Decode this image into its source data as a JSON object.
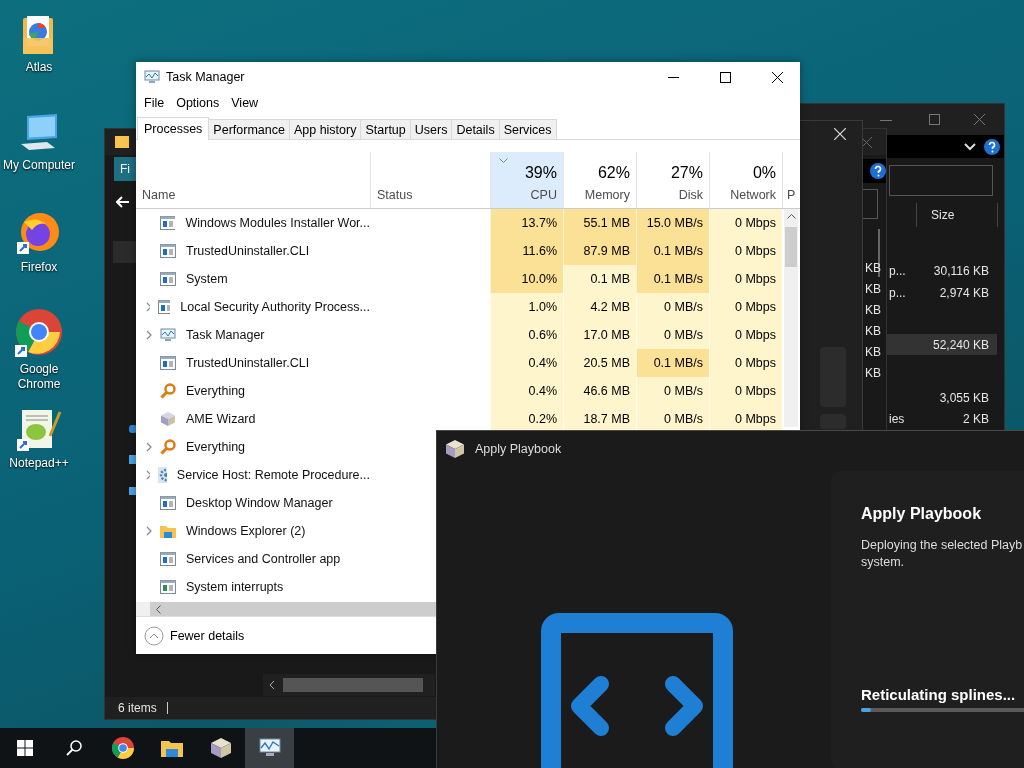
{
  "desktop_icons": [
    {
      "label": "Atlas",
      "kind": "atlas"
    },
    {
      "label": "My Computer",
      "kind": "computer"
    },
    {
      "label": "Firefox",
      "kind": "firefox"
    },
    {
      "label": "Google Chrome",
      "kind": "chrome"
    },
    {
      "label": "Notepad++",
      "kind": "notepad"
    }
  ],
  "explorer_back": {
    "column": "Size",
    "rows": [
      {
        "name": "p...",
        "size": "30,116 KB",
        "selected": false
      },
      {
        "name": "p...",
        "size": "2,974 KB",
        "selected": false
      },
      {
        "size": "52,240 KB",
        "selected": true
      },
      {
        "size": "3,055 KB",
        "selected": false
      },
      {
        "name": "ies",
        "size": "2 KB",
        "selected": false
      }
    ]
  },
  "explorer_front": {
    "tab": "Fi",
    "sizes": [
      "KB",
      "KB",
      "KB",
      "KB",
      "KB",
      "KB"
    ],
    "status": "6 items"
  },
  "task_manager": {
    "title": "Task Manager",
    "menu": [
      "File",
      "Options",
      "View"
    ],
    "tabs": [
      {
        "label": "Processes",
        "selected": true
      },
      {
        "label": "Performance",
        "selected": false
      },
      {
        "label": "App history",
        "selected": false
      },
      {
        "label": "Startup",
        "selected": false
      },
      {
        "label": "Users",
        "selected": false
      },
      {
        "label": "Details",
        "selected": false
      },
      {
        "label": "Services",
        "selected": false
      }
    ],
    "columns": [
      {
        "label": "Name"
      },
      {
        "label": "Status"
      },
      {
        "label": "CPU",
        "total": "39%",
        "sorted": true
      },
      {
        "label": "Memory",
        "total": "62%",
        "sorted": false
      },
      {
        "label": "Disk",
        "total": "27%",
        "sorted": false
      },
      {
        "label": "Network",
        "total": "0%",
        "sorted": false
      },
      {
        "label": "P"
      }
    ],
    "rows": [
      {
        "name": "Windows Modules Installer Wor...",
        "kind": "window",
        "expandable": false,
        "cells": [
          {
            "text": "13.7%",
            "busy": true
          },
          {
            "text": "55.1 MB",
            "busy": true
          },
          {
            "text": "15.0 MB/s",
            "busy": true
          },
          {
            "text": "0 Mbps",
            "busy": false
          }
        ]
      },
      {
        "name": "TrustedUninstaller.CLI",
        "kind": "window",
        "expandable": false,
        "cells": [
          {
            "text": "11.6%",
            "busy": true
          },
          {
            "text": "87.9 MB",
            "busy": true
          },
          {
            "text": "0.1 MB/s",
            "busy": true
          },
          {
            "text": "0 Mbps",
            "busy": false
          }
        ]
      },
      {
        "name": "System",
        "kind": "window",
        "expandable": false,
        "cells": [
          {
            "text": "10.0%",
            "busy": true
          },
          {
            "text": "0.1 MB",
            "busy": false
          },
          {
            "text": "0.1 MB/s",
            "busy": true
          },
          {
            "text": "0 Mbps",
            "busy": false
          }
        ]
      },
      {
        "name": "Local Security Authority Process...",
        "kind": "window",
        "expandable": true,
        "cells": [
          {
            "text": "1.0%",
            "busy": false
          },
          {
            "text": "4.2 MB",
            "busy": false
          },
          {
            "text": "0 MB/s",
            "busy": false
          },
          {
            "text": "0 Mbps",
            "busy": false
          }
        ]
      },
      {
        "name": "Task Manager",
        "kind": "chart",
        "expandable": true,
        "cells": [
          {
            "text": "0.6%",
            "busy": false
          },
          {
            "text": "17.0 MB",
            "busy": false
          },
          {
            "text": "0 MB/s",
            "busy": false
          },
          {
            "text": "0 Mbps",
            "busy": false
          }
        ]
      },
      {
        "name": "TrustedUninstaller.CLI",
        "kind": "window",
        "expandable": false,
        "cells": [
          {
            "text": "0.4%",
            "busy": false
          },
          {
            "text": "20.5 MB",
            "busy": false
          },
          {
            "text": "0.1 MB/s",
            "busy": true
          },
          {
            "text": "0 Mbps",
            "busy": false
          }
        ]
      },
      {
        "name": "Everything",
        "kind": "magnifier",
        "expandable": false,
        "cells": [
          {
            "text": "0.4%",
            "busy": false
          },
          {
            "text": "46.6 MB",
            "busy": false
          },
          {
            "text": "0 MB/s",
            "busy": false
          },
          {
            "text": "0 Mbps",
            "busy": false
          }
        ]
      },
      {
        "name": "AME Wizard",
        "kind": "cube",
        "expandable": false,
        "cells": [
          {
            "text": "0.2%",
            "busy": false
          },
          {
            "text": "18.7 MB",
            "busy": false
          },
          {
            "text": "0 MB/s",
            "busy": false
          },
          {
            "text": "0 Mbps",
            "busy": false
          }
        ]
      },
      {
        "name": "Everything",
        "kind": "magnifier",
        "expandable": true
      },
      {
        "name": "Service Host: Remote Procedure...",
        "kind": "gear",
        "expandable": true
      },
      {
        "name": "Desktop Window Manager",
        "kind": "window",
        "expandable": false
      },
      {
        "name": "Windows Explorer (2)",
        "kind": "folder",
        "expandable": true
      },
      {
        "name": "Services and Controller app",
        "kind": "window",
        "expandable": false
      },
      {
        "name": "System interrupts",
        "kind": "interrupt",
        "expandable": false
      }
    ],
    "footer": "Fewer details"
  },
  "playbook": {
    "title": "Apply Playbook",
    "heading": "Apply Playbook",
    "description_lines": [
      "Deploying the selected Playb",
      "system."
    ],
    "status": "Reticulating splines...",
    "progress": {
      "level": 0.06
    }
  },
  "taskbar": [
    {
      "kind": "start",
      "active": false
    },
    {
      "kind": "search",
      "active": false
    },
    {
      "kind": "chrome",
      "active": false
    },
    {
      "kind": "explorer",
      "active": false
    },
    {
      "kind": "cube",
      "active": false
    },
    {
      "kind": "taskmgr",
      "active": true
    }
  ]
}
